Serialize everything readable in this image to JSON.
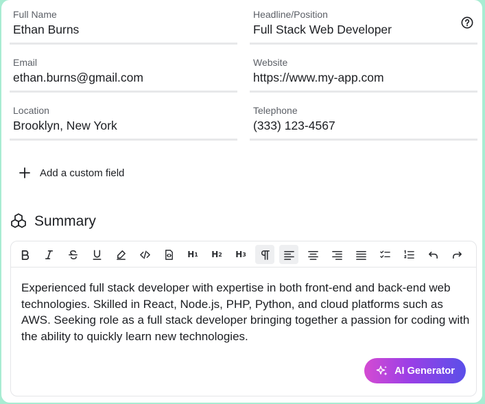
{
  "fields": [
    {
      "label": "Full Name",
      "value": "Ethan Burns"
    },
    {
      "label": "Headline/Position",
      "value": "Full Stack Web Developer"
    },
    {
      "label": "Email",
      "value": "ethan.burns@gmail.com"
    },
    {
      "label": "Website",
      "value": "https://www.my-app.com"
    },
    {
      "label": "Location",
      "value": "Brooklyn, New York"
    },
    {
      "label": "Telephone",
      "value": "(333) 123-4567"
    }
  ],
  "add_custom_field_label": "Add a custom field",
  "summary": {
    "title": "Summary",
    "toolbar": [
      "bold-icon",
      "italic-icon",
      "strikethrough-icon",
      "underline-icon",
      "highlight-icon",
      "code-icon",
      "code-block-icon",
      "heading-1",
      "heading-2",
      "heading-3",
      "paragraph-icon",
      "align-left-icon",
      "align-center-icon",
      "align-right-icon",
      "align-justify-icon",
      "task-list-icon",
      "ordered-list-icon",
      "undo-icon",
      "redo-icon"
    ],
    "text": "Experienced full stack developer with expertise in both front-end and back-end web technologies. Skilled in React, Node.js, PHP, Python, and cloud platforms such as AWS. Seeking role as a full stack developer bringing together a passion for coding with the ability to quickly learn new technologies.",
    "ai_button_label": "AI Generator"
  },
  "colors": {
    "background": "#a8ecd2",
    "ai_gradient_start": "#d44bd2",
    "ai_gradient_end": "#5a4fe9"
  }
}
